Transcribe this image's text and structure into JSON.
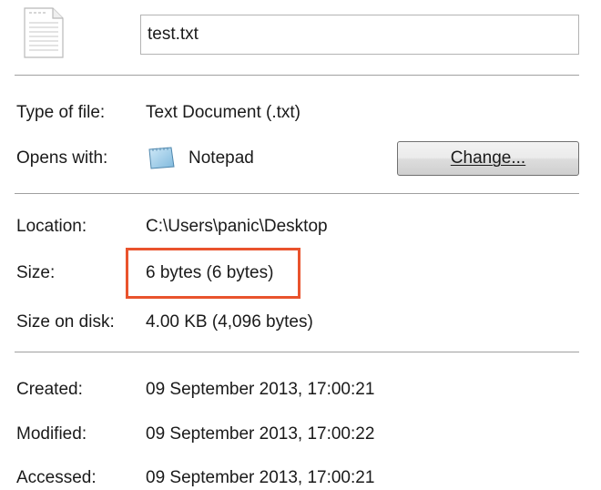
{
  "file": {
    "name": "test.txt",
    "icon": "text-file-icon"
  },
  "type_row": {
    "label": "Type of file:",
    "value": "Text Document (.txt)"
  },
  "opens_row": {
    "label": "Opens with:",
    "app_icon": "notepad-icon",
    "app_name": "Notepad",
    "change_label": "Change..."
  },
  "location_row": {
    "label": "Location:",
    "value": "C:\\Users\\panic\\Desktop"
  },
  "size_row": {
    "label": "Size:",
    "value": "6 bytes (6 bytes)",
    "highlight_color": "#e9532d"
  },
  "size_on_disk_row": {
    "label": "Size on disk:",
    "value": "4.00 KB (4,096 bytes)"
  },
  "created_row": {
    "label": "Created:",
    "value": "09 September 2013, 17:00:21"
  },
  "modified_row": {
    "label": "Modified:",
    "value": "09 September 2013, 17:00:22"
  },
  "accessed_row": {
    "label": "Accessed:",
    "value": "09 September 2013, 17:00:21"
  }
}
